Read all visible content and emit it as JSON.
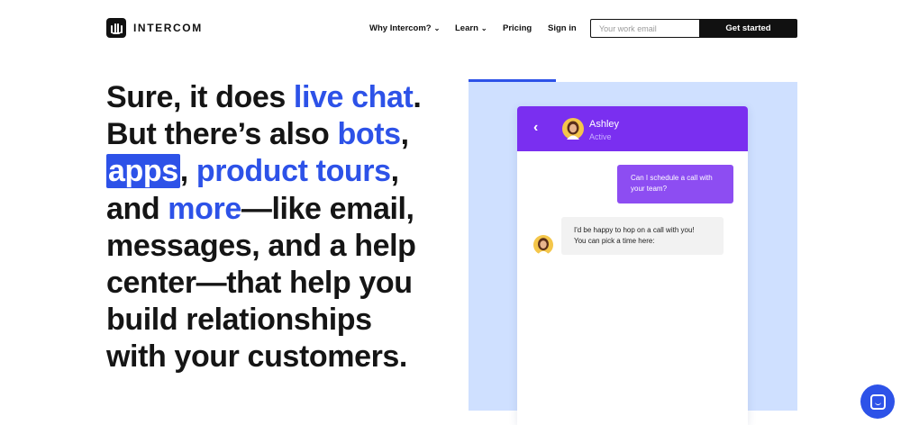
{
  "header": {
    "logo_text": "INTERCOM",
    "nav": [
      {
        "label": "Why Intercom?",
        "has_dropdown": true
      },
      {
        "label": "Learn",
        "has_dropdown": true
      },
      {
        "label": "Pricing",
        "has_dropdown": false
      },
      {
        "label": "Sign in",
        "has_dropdown": false
      }
    ],
    "email_placeholder": "Your work email",
    "cta_label": "Get started"
  },
  "hero": {
    "line1_a": "Sure, it does ",
    "line1_hl": "live chat",
    "line1_b": ".",
    "line2_a": "But there’s also ",
    "line2_hl": "bots",
    "line2_b": ",",
    "line3_box": "apps",
    "line3_a": ", ",
    "line3_hl": "product tours",
    "line3_b": ",",
    "line4_a": "and ",
    "line4_hl": "more",
    "line4_b": "—like email,",
    "line5": "messages, and a help",
    "line6": "center—that help you",
    "line7": "build relationships",
    "line8": "with your customers."
  },
  "chat": {
    "agent_name": "Ashley",
    "agent_status": "Active",
    "user_message_line1": "Can I schedule a call with",
    "user_message_line2": "your team?",
    "reply_line1": "I'd be happy to hop on a call with you!",
    "reply_line2": "You can pick a time here:"
  },
  "colors": {
    "accent": "#2d52e8",
    "chat_header": "#7a2ff0",
    "user_bubble": "#8d4df2",
    "illustration_bg": "#cfe0ff"
  },
  "icons": {
    "back": "chevron-left-icon",
    "launcher": "messenger-icon",
    "dropdown": "chevron-down-icon"
  }
}
